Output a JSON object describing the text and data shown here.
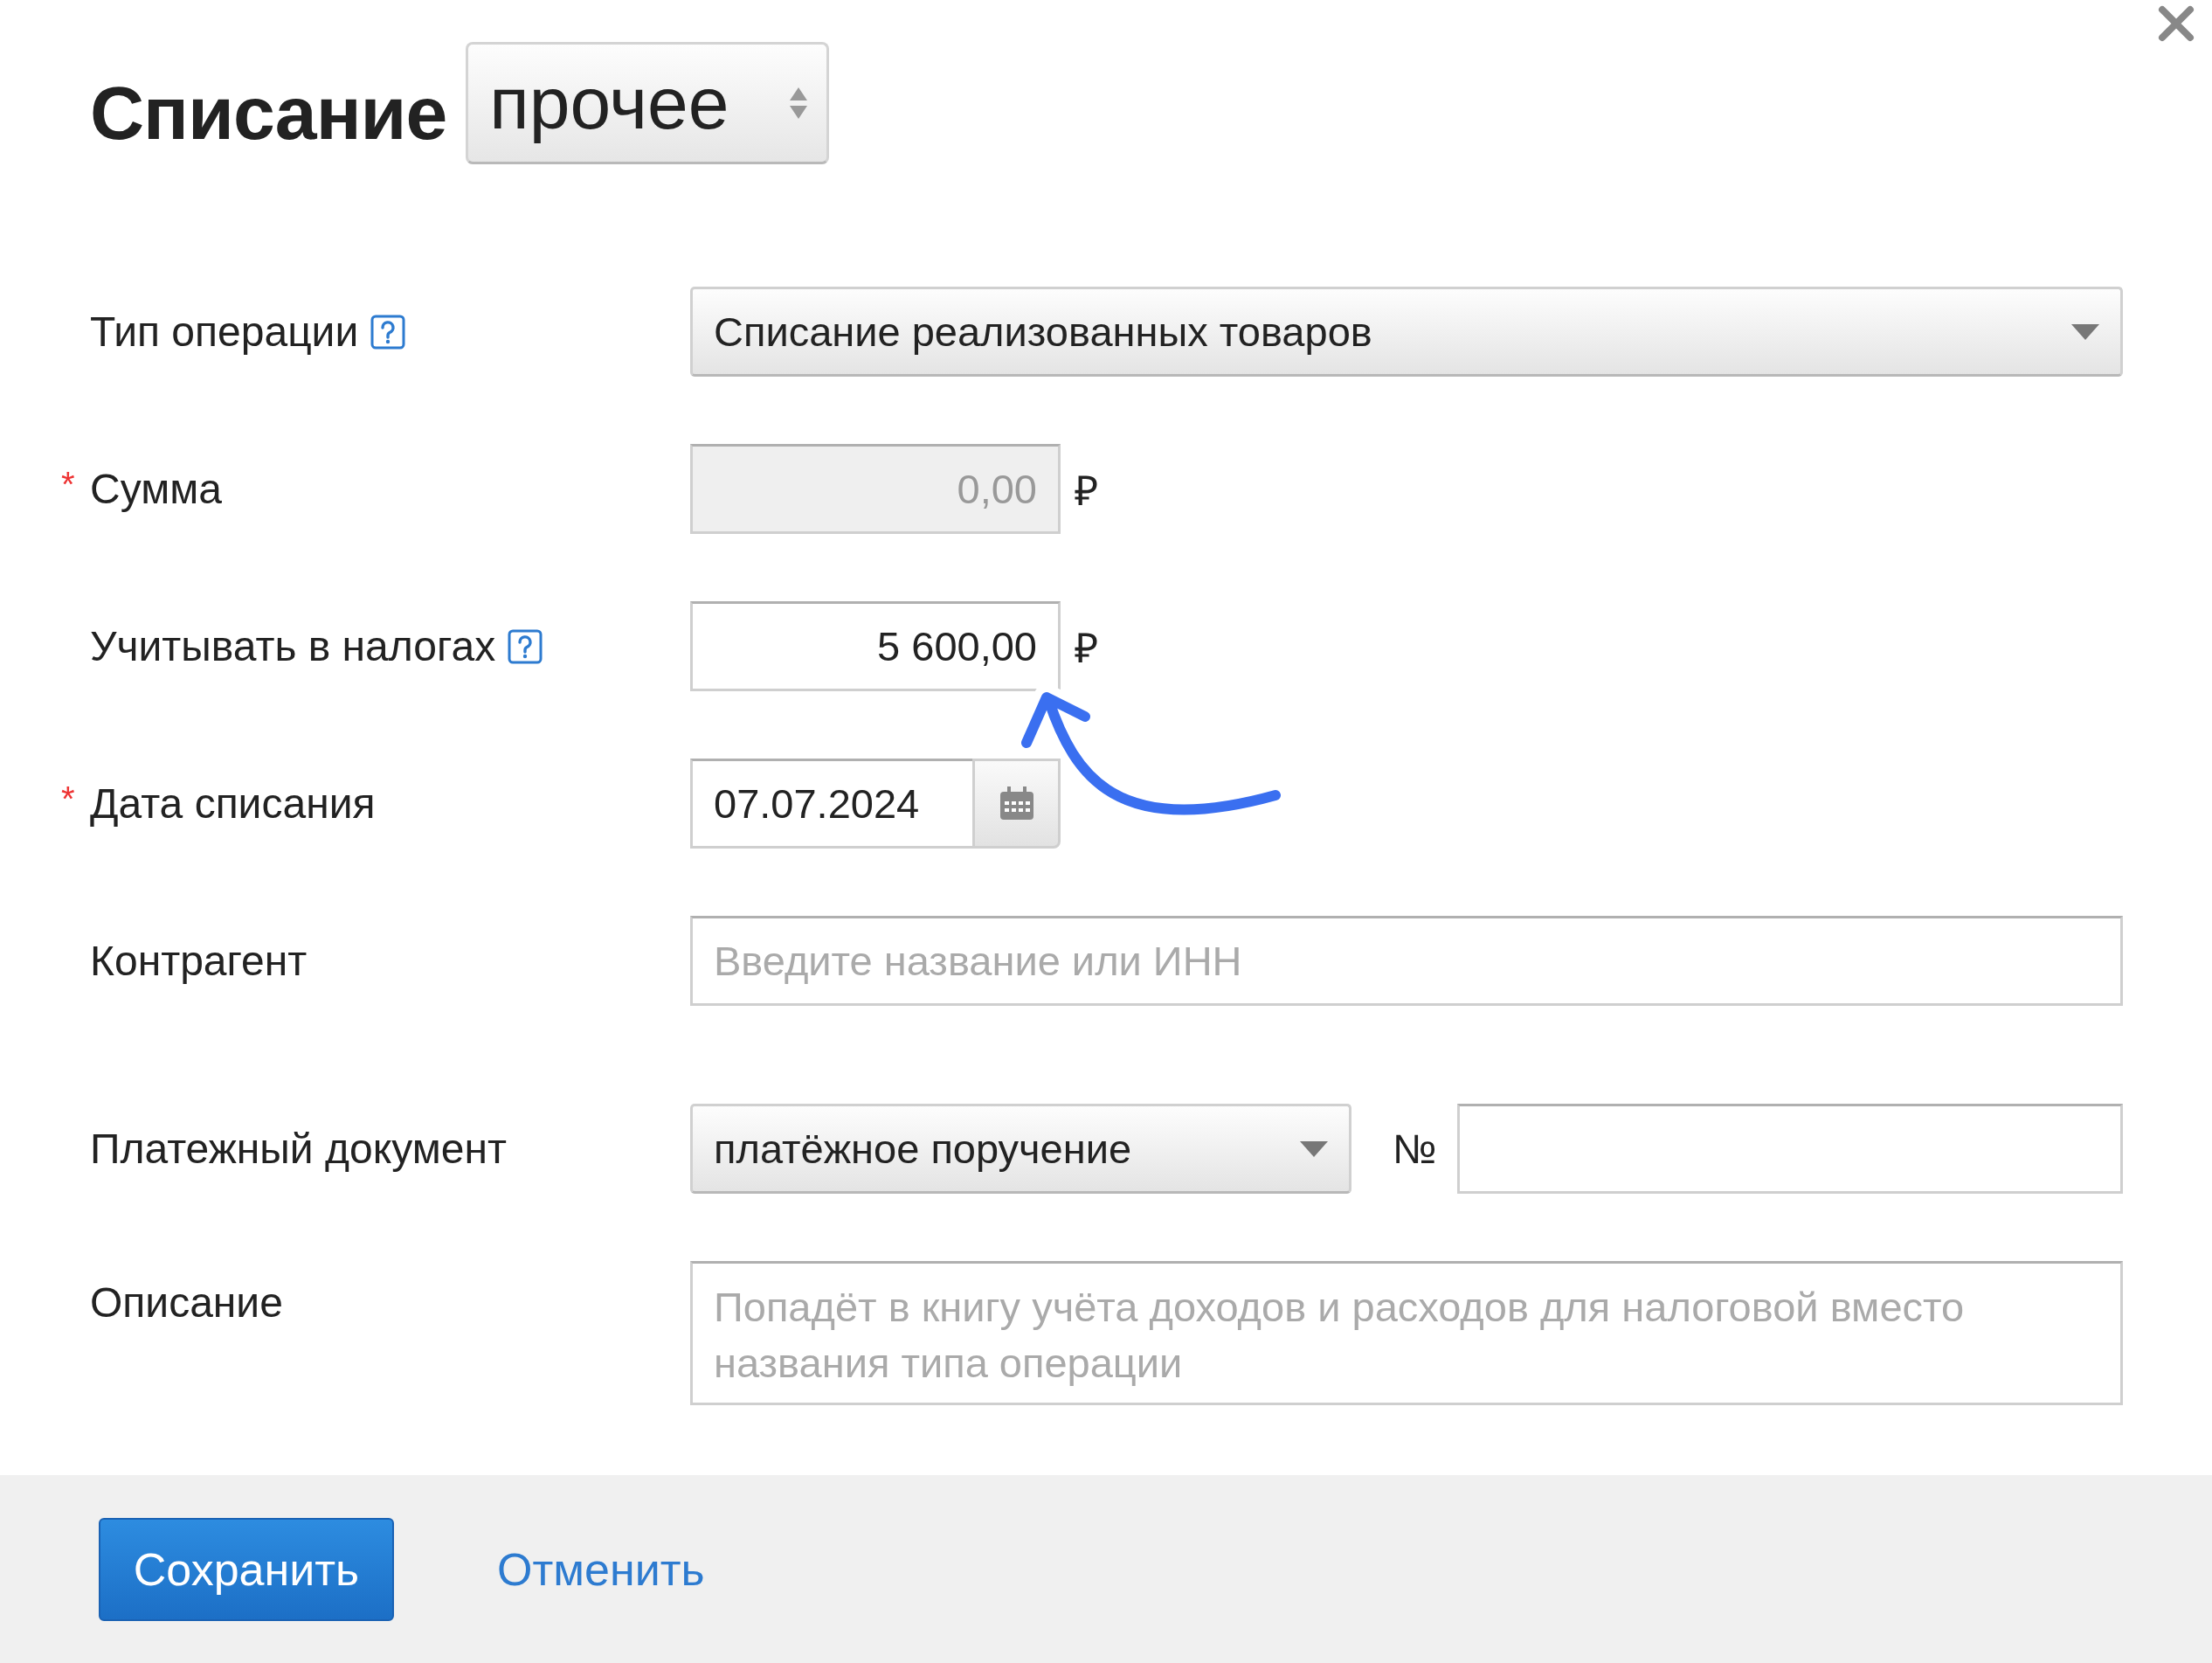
{
  "title": "Списание",
  "type_select": {
    "value": "прочее"
  },
  "fields": [
    {
      "kind": "select",
      "label": "Тип операции",
      "help": true,
      "value": "Списание реализованных товаров"
    },
    {
      "kind": "money",
      "label": "Сумма",
      "help": false,
      "required_mark": "*",
      "disabled": true,
      "value": "0,00",
      "currency": "₽"
    },
    {
      "kind": "money",
      "label": "Учитывать в налогах",
      "help": true,
      "disabled": false,
      "value": "5 600,00",
      "currency": "₽"
    },
    {
      "kind": "date",
      "label": "Дата списания",
      "help": false,
      "required_mark": "*",
      "value": "07.07.2024"
    },
    {
      "kind": "text",
      "label": "Контрагент",
      "help": false,
      "placeholder": "Введите название или ИНН"
    },
    {
      "kind": "payment",
      "label": "Платежный документ",
      "help": false,
      "value": "платёжное поручение",
      "number_label": "№"
    },
    {
      "kind": "textarea",
      "label": "Описание",
      "help": false,
      "placeholder": "Попадёт в книгу учёта доходов и расходов для налоговой вместо названия типа операции"
    }
  ],
  "buttons": [
    {
      "kind": "primary",
      "label": "Сохранить"
    },
    {
      "kind": "link",
      "label": "Отменить"
    }
  ]
}
